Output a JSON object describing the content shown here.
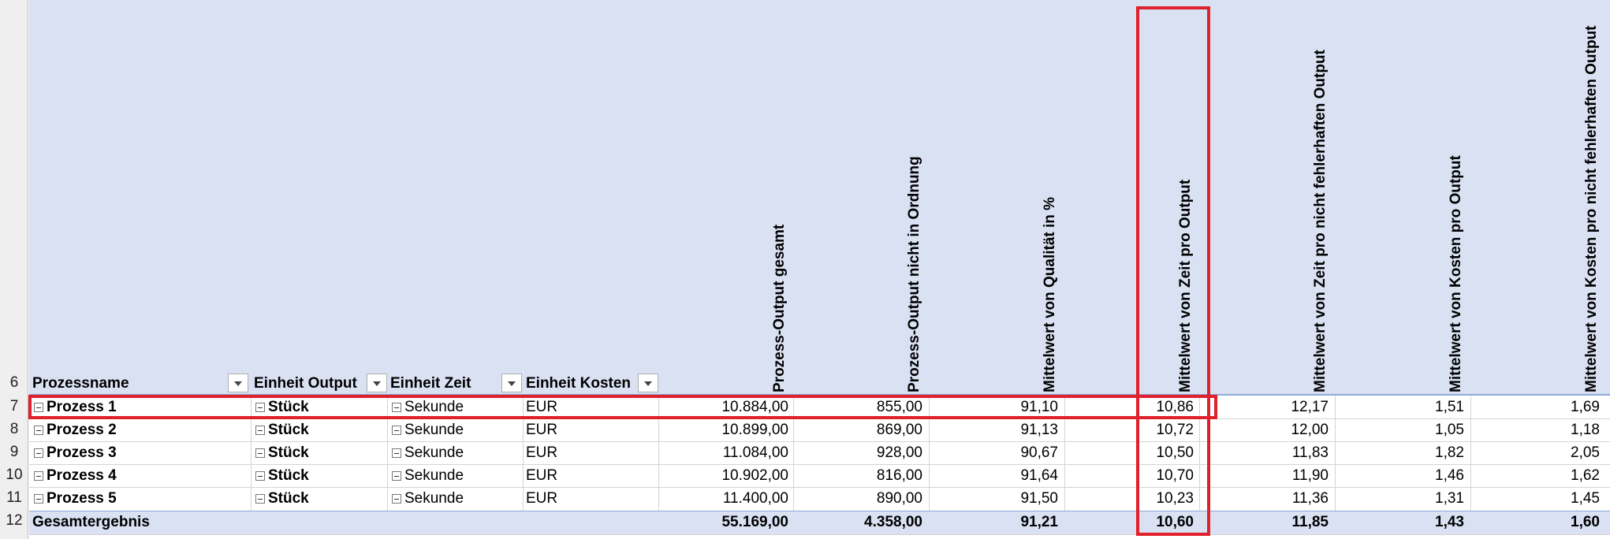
{
  "row_numbers": [
    "6",
    "7",
    "8",
    "9",
    "10",
    "11",
    "12"
  ],
  "headers": {
    "prozessname": "Prozessname",
    "einheit_output": "Einheit Output",
    "einheit_zeit": "Einheit Zeit",
    "einheit_kosten": "Einheit Kosten",
    "prozess_output_gesamt": "Prozess-Output gesamt",
    "prozess_output_nicht_in_ordnung": "Prozess-Output nicht in Ordnung",
    "mittelwert_qualitaet": "Mittelwert von Qualität in %",
    "mittelwert_zeit_pro_output": "Mittelwert von Zeit pro Output",
    "mittelwert_zeit_nicht_fehlerhaft": "Mittelwert von Zeit pro nicht fehlerhaften Output",
    "mittelwert_kosten_pro_output": "Mittelwert von Kosten pro Output",
    "mittelwert_kosten_nicht_fehlerhaft": "Mittelwert von Kosten pro nicht fehlerhaften Output"
  },
  "rows": [
    {
      "name": "Prozess 1",
      "output": "Stück",
      "zeit": "Sekunde",
      "kosten": "EUR",
      "gesamt": "10.884,00",
      "nio": "855,00",
      "qualitaet": "91,10",
      "zeit_pro": "10,86",
      "zeit_nf": "12,17",
      "kosten_pro": "1,51",
      "kosten_nf": "1,69"
    },
    {
      "name": "Prozess 2",
      "output": "Stück",
      "zeit": "Sekunde",
      "kosten": "EUR",
      "gesamt": "10.899,00",
      "nio": "869,00",
      "qualitaet": "91,13",
      "zeit_pro": "10,72",
      "zeit_nf": "12,00",
      "kosten_pro": "1,05",
      "kosten_nf": "1,18"
    },
    {
      "name": "Prozess 3",
      "output": "Stück",
      "zeit": "Sekunde",
      "kosten": "EUR",
      "gesamt": "11.084,00",
      "nio": "928,00",
      "qualitaet": "90,67",
      "zeit_pro": "10,50",
      "zeit_nf": "11,83",
      "kosten_pro": "1,82",
      "kosten_nf": "2,05"
    },
    {
      "name": "Prozess 4",
      "output": "Stück",
      "zeit": "Sekunde",
      "kosten": "EUR",
      "gesamt": "10.902,00",
      "nio": "816,00",
      "qualitaet": "91,64",
      "zeit_pro": "10,70",
      "zeit_nf": "11,90",
      "kosten_pro": "1,46",
      "kosten_nf": "1,62"
    },
    {
      "name": "Prozess 5",
      "output": "Stück",
      "zeit": "Sekunde",
      "kosten": "EUR",
      "gesamt": "11.400,00",
      "nio": "890,00",
      "qualitaet": "91,50",
      "zeit_pro": "10,23",
      "zeit_nf": "11,36",
      "kosten_pro": "1,31",
      "kosten_nf": "1,45"
    }
  ],
  "total": {
    "label": "Gesamtergebnis",
    "gesamt": "55.169,00",
    "nio": "4.358,00",
    "qualitaet": "91,21",
    "zeit_pro": "10,60",
    "zeit_nf": "11,85",
    "kosten_pro": "1,43",
    "kosten_nf": "1,60"
  },
  "colors": {
    "header_band": "#d9e1f2",
    "highlight": "#e0202a"
  }
}
